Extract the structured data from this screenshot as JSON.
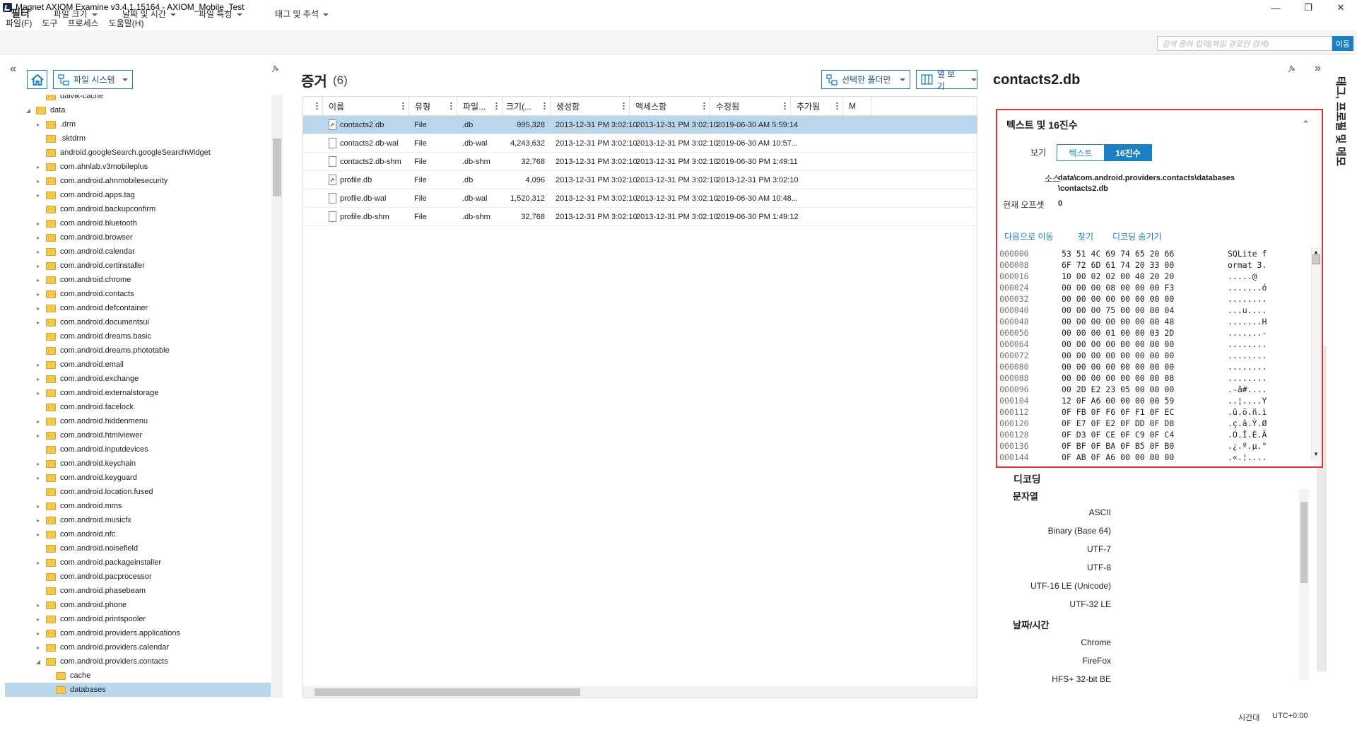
{
  "window": {
    "title": "Magnet AXIOM Examine v3.4.1.15164 - AXIOM_Mobile_Test",
    "minimize": "—",
    "maximize": "❐",
    "close": "✕"
  },
  "menu": [
    "파일(F)",
    "도구",
    "프로세스",
    "도움말(H)"
  ],
  "filterbar": {
    "label": "필터",
    "dropdowns": [
      "파일 크기",
      "날짜 및 시간",
      "파일 특성",
      "태그 및 주석"
    ],
    "search_placeholder": "검색 용어 입력(파일 경로만 검색)",
    "search_button": "이동"
  },
  "left_panel": {
    "collapse": "«",
    "view_selector": "파일 시스템",
    "tree": [
      {
        "label": "dalvik-cache",
        "depth": 1,
        "expander": "",
        "selected": false
      },
      {
        "label": "data",
        "depth": 0,
        "expander": "◢",
        "selected": false
      },
      {
        "label": ".drm",
        "depth": 1,
        "expander": "▸",
        "selected": false
      },
      {
        "label": ".sktdrm",
        "depth": 1,
        "expander": "",
        "selected": false
      },
      {
        "label": "android.googleSearch.googleSearchWidget",
        "depth": 1,
        "expander": "",
        "selected": false
      },
      {
        "label": "com.ahnlab.v3mobileplus",
        "depth": 1,
        "expander": "▸",
        "selected": false
      },
      {
        "label": "com.android.ahnmobilesecurity",
        "depth": 1,
        "expander": "▸",
        "selected": false
      },
      {
        "label": "com.android.apps.tag",
        "depth": 1,
        "expander": "▸",
        "selected": false
      },
      {
        "label": "com.android.backupconfirm",
        "depth": 1,
        "expander": "",
        "selected": false
      },
      {
        "label": "com.android.bluetooth",
        "depth": 1,
        "expander": "▸",
        "selected": false
      },
      {
        "label": "com.android.browser",
        "depth": 1,
        "expander": "▸",
        "selected": false
      },
      {
        "label": "com.android.calendar",
        "depth": 1,
        "expander": "▸",
        "selected": false
      },
      {
        "label": "com.android.certinstaller",
        "depth": 1,
        "expander": "▸",
        "selected": false
      },
      {
        "label": "com.android.chrome",
        "depth": 1,
        "expander": "▸",
        "selected": false
      },
      {
        "label": "com.android.contacts",
        "depth": 1,
        "expander": "▸",
        "selected": false
      },
      {
        "label": "com.android.defcontainer",
        "depth": 1,
        "expander": "▸",
        "selected": false
      },
      {
        "label": "com.android.documentsui",
        "depth": 1,
        "expander": "▸",
        "selected": false
      },
      {
        "label": "com.android.dreams.basic",
        "depth": 1,
        "expander": "",
        "selected": false
      },
      {
        "label": "com.android.dreams.phototable",
        "depth": 1,
        "expander": "",
        "selected": false
      },
      {
        "label": "com.android.email",
        "depth": 1,
        "expander": "▸",
        "selected": false
      },
      {
        "label": "com.android.exchange",
        "depth": 1,
        "expander": "▸",
        "selected": false
      },
      {
        "label": "com.android.externalstorage",
        "depth": 1,
        "expander": "▸",
        "selected": false
      },
      {
        "label": "com.android.facelock",
        "depth": 1,
        "expander": "",
        "selected": false
      },
      {
        "label": "com.android.hiddenmenu",
        "depth": 1,
        "expander": "▸",
        "selected": false
      },
      {
        "label": "com.android.htmlviewer",
        "depth": 1,
        "expander": "▸",
        "selected": false
      },
      {
        "label": "com.android.inputdevices",
        "depth": 1,
        "expander": "",
        "selected": false
      },
      {
        "label": "com.android.keychain",
        "depth": 1,
        "expander": "▸",
        "selected": false
      },
      {
        "label": "com.android.keyguard",
        "depth": 1,
        "expander": "▸",
        "selected": false
      },
      {
        "label": "com.android.location.fused",
        "depth": 1,
        "expander": "",
        "selected": false
      },
      {
        "label": "com.android.mms",
        "depth": 1,
        "expander": "▸",
        "selected": false
      },
      {
        "label": "com.android.musicfx",
        "depth": 1,
        "expander": "▸",
        "selected": false
      },
      {
        "label": "com.android.nfc",
        "depth": 1,
        "expander": "▸",
        "selected": false
      },
      {
        "label": "com.android.noisefield",
        "depth": 1,
        "expander": "",
        "selected": false
      },
      {
        "label": "com.android.packageinstaller",
        "depth": 1,
        "expander": "▸",
        "selected": false
      },
      {
        "label": "com.android.pacprocessor",
        "depth": 1,
        "expander": "",
        "selected": false
      },
      {
        "label": "com.android.phasebeam",
        "depth": 1,
        "expander": "",
        "selected": false
      },
      {
        "label": "com.android.phone",
        "depth": 1,
        "expander": "▸",
        "selected": false
      },
      {
        "label": "com.android.printspooler",
        "depth": 1,
        "expander": "▸",
        "selected": false
      },
      {
        "label": "com.android.providers.applications",
        "depth": 1,
        "expander": "▸",
        "selected": false
      },
      {
        "label": "com.android.providers.calendar",
        "depth": 1,
        "expander": "▸",
        "selected": false
      },
      {
        "label": "com.android.providers.contacts",
        "depth": 1,
        "expander": "◢",
        "selected": false
      },
      {
        "label": "cache",
        "depth": 2,
        "expander": "",
        "selected": false
      },
      {
        "label": "databases",
        "depth": 2,
        "expander": "",
        "selected": true
      }
    ]
  },
  "evidence": {
    "title": "증거",
    "count": "(6)",
    "folder_button": "선택한 폴더만",
    "columns_button": "열 보기",
    "columns": [
      "이름",
      "유형",
      "파일...",
      "크기(...",
      "생성함",
      "액세스함",
      "수정됨",
      "추가됨",
      "M"
    ],
    "rows": [
      {
        "name": "contacts2.db",
        "type": "File",
        "ext": ".db",
        "size": "995,328",
        "created": "2013-12-31 PM 3:02:10",
        "accessed": "2013-12-31 PM 3:02:10",
        "modified": "2019-06-30 AM 5:59:14",
        "db": true,
        "selected": true
      },
      {
        "name": "contacts2.db-wal",
        "type": "File",
        "ext": ".db-wal",
        "size": "4,243,632",
        "created": "2013-12-31 PM 3:02:10",
        "accessed": "2013-12-31 PM 3:02:10",
        "modified": "2019-06-30 AM 10:57...",
        "db": false,
        "selected": false
      },
      {
        "name": "contacts2.db-shm",
        "type": "File",
        "ext": ".db-shm",
        "size": "32,768",
        "created": "2013-12-31 PM 3:02:10",
        "accessed": "2013-12-31 PM 3:02:10",
        "modified": "2019-06-30 PM 1:49:11",
        "db": false,
        "selected": false
      },
      {
        "name": "profile.db",
        "type": "File",
        "ext": ".db",
        "size": "4,096",
        "created": "2013-12-31 PM 3:02:10",
        "accessed": "2013-12-31 PM 3:02:10",
        "modified": "2013-12-31 PM 3:02:10",
        "db": true,
        "selected": false
      },
      {
        "name": "profile.db-wal",
        "type": "File",
        "ext": ".db-wal",
        "size": "1,520,312",
        "created": "2013-12-31 PM 3:02:10",
        "accessed": "2013-12-31 PM 3:02:10",
        "modified": "2019-06-30 AM 10:48...",
        "db": false,
        "selected": false
      },
      {
        "name": "profile.db-shm",
        "type": "File",
        "ext": ".db-shm",
        "size": "32,768",
        "created": "2013-12-31 PM 3:02:10",
        "accessed": "2013-12-31 PM 3:02:10",
        "modified": "2019-06-30 PM 1:49:12",
        "db": false,
        "selected": false
      }
    ]
  },
  "details": {
    "title": "contacts2.db",
    "section_title": "텍스트 및 16진수",
    "view_label": "보기",
    "toggle_text": "텍스트",
    "toggle_hex": "16진수",
    "source_label": "소스",
    "source_value_1": "data\\com.android.providers.contacts\\databases",
    "source_value_2": "\\contacts2.db",
    "offset_label": "현재 오프셋",
    "offset_value": "0",
    "link_goto": "다음으로 이동",
    "link_find": "찾기",
    "link_hide_decode": "디코딩 숨기기",
    "hex_rows": [
      {
        "offset": "000000",
        "bytes": "53 51 4C 69 74 65 20 66",
        "ascii": "SQLite f"
      },
      {
        "offset": "000008",
        "bytes": "6F 72 6D 61 74 20 33 00",
        "ascii": "ormat 3."
      },
      {
        "offset": "000016",
        "bytes": "10 00 02 02 00 40 20 20",
        "ascii": ".....@  "
      },
      {
        "offset": "000024",
        "bytes": "00 00 00 08 00 00 00 F3",
        "ascii": ".......ó"
      },
      {
        "offset": "000032",
        "bytes": "00 00 00 00 00 00 00 00",
        "ascii": "........"
      },
      {
        "offset": "000040",
        "bytes": "00 00 00 75 00 00 00 04",
        "ascii": "...u...."
      },
      {
        "offset": "000048",
        "bytes": "00 00 00 00 00 00 00 48",
        "ascii": ".......H"
      },
      {
        "offset": "000056",
        "bytes": "00 00 00 01 00 00 03 2D",
        "ascii": ".......-"
      },
      {
        "offset": "000064",
        "bytes": "00 00 00 00 00 00 00 00",
        "ascii": "........"
      },
      {
        "offset": "000072",
        "bytes": "00 00 00 00 00 00 00 00",
        "ascii": "........"
      },
      {
        "offset": "000080",
        "bytes": "00 00 00 00 00 00 00 00",
        "ascii": "........"
      },
      {
        "offset": "000088",
        "bytes": "00 00 00 00 00 00 00 08",
        "ascii": "........"
      },
      {
        "offset": "000096",
        "bytes": "00 2D E2 23 05 00 00 00",
        "ascii": ".-â#...."
      },
      {
        "offset": "000104",
        "bytes": "12 0F A6 00 00 00 00 59",
        "ascii": "..¦....Y"
      },
      {
        "offset": "000112",
        "bytes": "0F FB 0F F6 0F F1 0F EC",
        "ascii": ".û.ö.ñ.ì"
      },
      {
        "offset": "000120",
        "bytes": "0F E7 0F E2 0F DD 0F D8",
        "ascii": ".ç.â.Ý.Ø"
      },
      {
        "offset": "000128",
        "bytes": "0F D3 0F CE 0F C9 0F C4",
        "ascii": ".Ó.Î.É.Ä"
      },
      {
        "offset": "000136",
        "bytes": "0F BF 0F BA 0F B5 0F B0",
        "ascii": ".¿.º.µ.°"
      },
      {
        "offset": "000144",
        "bytes": "0F AB 0F A6 00 00 00 00",
        "ascii": ".«.¦...."
      }
    ],
    "decoding_title": "디코딩",
    "strings_title": "문자열",
    "strings": [
      "ASCII",
      "Binary (Base 64)",
      "UTF-7",
      "UTF-8",
      "UTF-16 LE (Unicode)",
      "UTF-32 LE"
    ],
    "datetime_title": "날짜/시간",
    "datetime": [
      "Chrome",
      "FireFox",
      "HFS+ 32-bit BE"
    ],
    "side_tab": "태그, 프로필 및 메모"
  },
  "status": {
    "timezone_label": "시간대",
    "timezone_value": "UTC+0:00"
  }
}
